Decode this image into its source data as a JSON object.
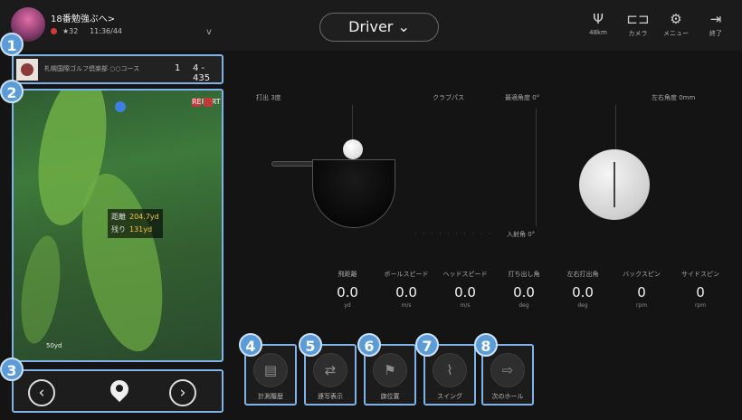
{
  "topbar": {
    "user_name": "18番勉強ぶへ>",
    "user_sub1": "★32",
    "user_sub2": "11:36/44",
    "chevron": "v",
    "club_label": "Driver",
    "club_chevron": "⌄",
    "icons": [
      {
        "name": "signal-icon",
        "glyph": "Ψ",
        "label": "48km"
      },
      {
        "name": "camera-icon",
        "glyph": "⊏⊐",
        "label": "カメラ"
      },
      {
        "name": "settings-icon",
        "glyph": "⚙",
        "label": "メニュー"
      },
      {
        "name": "exit-icon",
        "glyph": "⇥",
        "label": "終了"
      }
    ]
  },
  "hole": {
    "name": "札幌国際ゴルフ倶楽部 ○○コース",
    "number": "1",
    "par": "4 - 435"
  },
  "map": {
    "badge_label": "REPORT",
    "distance_label": "距離",
    "distance_value": "204.7yd",
    "remain_label": "残り",
    "remain_value": "131yd",
    "scale": "50yd"
  },
  "nav": {
    "prev": "‹",
    "next": "›"
  },
  "badges": [
    "1",
    "2",
    "3",
    "4",
    "5",
    "6",
    "7",
    "8"
  ],
  "stage": {
    "label_left": "打出 3度",
    "label_mid": "クラブパス",
    "label_mid2": "最適角度 0°",
    "label_right": "左右角度 0mm",
    "label_lower": "入射角 0°"
  },
  "metrics": [
    {
      "title": "飛距離",
      "value": "0.0",
      "unit": "yd"
    },
    {
      "title": "ボールスピード",
      "value": "0.0",
      "unit": "m/s"
    },
    {
      "title": "ヘッドスピード",
      "value": "0.0",
      "unit": "m/s"
    },
    {
      "title": "打ち出し角",
      "value": "0.0",
      "unit": "deg"
    },
    {
      "title": "左右打出角",
      "value": "0.0",
      "unit": "deg"
    },
    {
      "title": "バックスピン",
      "value": "0",
      "unit": "rpm"
    },
    {
      "title": "サイドスピン",
      "value": "0",
      "unit": "rpm"
    }
  ],
  "tools": [
    {
      "name": "tool-history-button",
      "glyph": "▤",
      "label": "計測履歴"
    },
    {
      "name": "tool-replay-button",
      "glyph": "⇄",
      "label": "連写表示"
    },
    {
      "name": "tool-flag-button",
      "glyph": "⚑",
      "label": "旗位置"
    },
    {
      "name": "tool-swing-button",
      "glyph": "⌇",
      "label": "スイング"
    },
    {
      "name": "tool-next-button",
      "glyph": "⇨",
      "label": "次のホール"
    }
  ]
}
